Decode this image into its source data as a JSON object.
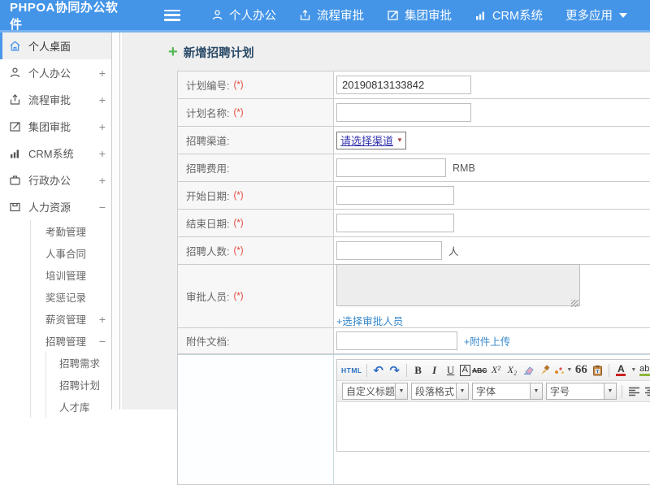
{
  "topbar": {
    "logo": "PHPOA协同办公软件",
    "menu": [
      {
        "label": "个人办公"
      },
      {
        "label": "流程审批"
      },
      {
        "label": "集团审批"
      },
      {
        "label": "CRM系统"
      },
      {
        "label": "更多应用"
      }
    ],
    "accent_color": "#4495e8"
  },
  "sidebar": {
    "items": [
      {
        "label": "个人桌面",
        "active": true
      },
      {
        "label": "个人办公",
        "expander": "+"
      },
      {
        "label": "流程审批",
        "expander": "+"
      },
      {
        "label": "集团审批",
        "expander": "+"
      },
      {
        "label": "CRM系统",
        "expander": "+"
      },
      {
        "label": "行政办公",
        "expander": "+"
      },
      {
        "label": "人力资源",
        "expander": "−",
        "children": [
          {
            "label": "考勤管理"
          },
          {
            "label": "人事合同"
          },
          {
            "label": "培训管理"
          },
          {
            "label": "奖惩记录"
          },
          {
            "label": "薪资管理",
            "expander": "+"
          },
          {
            "label": "招聘管理",
            "expander": "−",
            "children": [
              {
                "label": "招聘需求"
              },
              {
                "label": "招聘计划"
              },
              {
                "label": "人才库"
              }
            ]
          }
        ]
      }
    ]
  },
  "main": {
    "title": "新增招聘计划",
    "form": {
      "rows": [
        {
          "label": "计划编号:",
          "required": "(*)",
          "value": "20190813133842"
        },
        {
          "label": "计划名称:",
          "required": "(*)"
        },
        {
          "label": "招聘渠道:",
          "select_value": "请选择渠道"
        },
        {
          "label": "招聘费用:",
          "suffix": "RMB"
        },
        {
          "label": "开始日期:",
          "required": "(*)"
        },
        {
          "label": "结束日期:",
          "required": "(*)"
        },
        {
          "label": "招聘人数:",
          "required": "(*)",
          "suffix": "人"
        },
        {
          "label": "审批人员:",
          "required": "(*)",
          "link": "+选择审批人员"
        },
        {
          "label": "附件文档:",
          "link": "+附件上传"
        }
      ]
    }
  },
  "editor": {
    "source": "HTML",
    "undo": "↶",
    "redo": "↷",
    "bold": "B",
    "italic": "I",
    "underline": "U",
    "autotypeset": "A",
    "strikethrough": "ABC",
    "superscript": "X²",
    "subscript": "X₂",
    "blockquote": "66",
    "forecolor": "A",
    "backcolor": "ab",
    "caret": "▼",
    "dropdowns": [
      {
        "label": "自定义标题"
      },
      {
        "label": "段落格式"
      },
      {
        "label": "字体"
      },
      {
        "label": "字号"
      }
    ]
  }
}
